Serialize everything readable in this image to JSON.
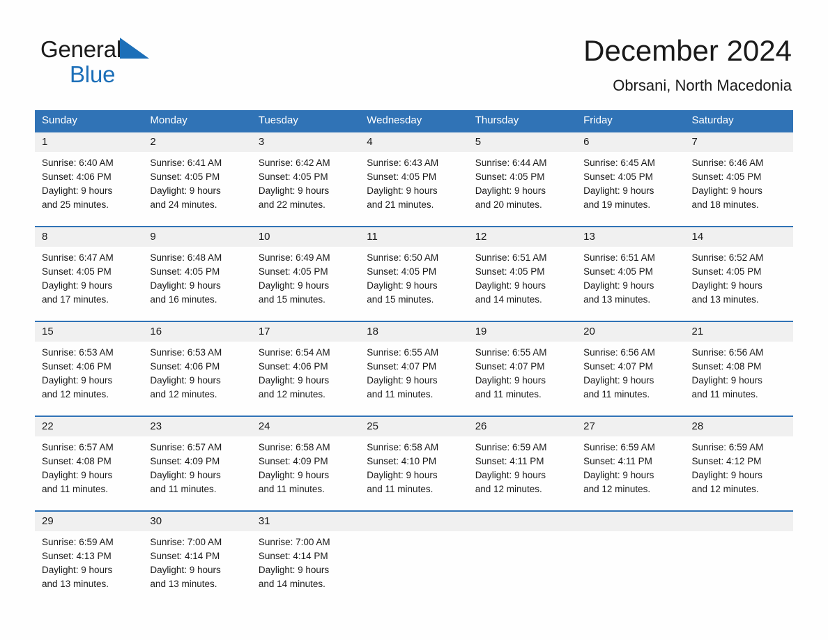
{
  "brand": {
    "name_part1": "General",
    "name_part2": "Blue",
    "triangle_icon": "triangle-icon",
    "accent_color": "#1C6FB8"
  },
  "header": {
    "month_title": "December 2024",
    "location": "Obrsani, North Macedonia",
    "header_bg_color": "#3073B6",
    "day_band_color": "#F0F0F0"
  },
  "weekday_headers": [
    "Sunday",
    "Monday",
    "Tuesday",
    "Wednesday",
    "Thursday",
    "Friday",
    "Saturday"
  ],
  "weeks": [
    {
      "numbers": [
        "1",
        "2",
        "3",
        "4",
        "5",
        "6",
        "7"
      ],
      "cells": [
        {
          "sunrise": "Sunrise: 6:40 AM",
          "sunset": "Sunset: 4:06 PM",
          "daylight1": "Daylight: 9 hours",
          "daylight2": "and 25 minutes."
        },
        {
          "sunrise": "Sunrise: 6:41 AM",
          "sunset": "Sunset: 4:05 PM",
          "daylight1": "Daylight: 9 hours",
          "daylight2": "and 24 minutes."
        },
        {
          "sunrise": "Sunrise: 6:42 AM",
          "sunset": "Sunset: 4:05 PM",
          "daylight1": "Daylight: 9 hours",
          "daylight2": "and 22 minutes."
        },
        {
          "sunrise": "Sunrise: 6:43 AM",
          "sunset": "Sunset: 4:05 PM",
          "daylight1": "Daylight: 9 hours",
          "daylight2": "and 21 minutes."
        },
        {
          "sunrise": "Sunrise: 6:44 AM",
          "sunset": "Sunset: 4:05 PM",
          "daylight1": "Daylight: 9 hours",
          "daylight2": "and 20 minutes."
        },
        {
          "sunrise": "Sunrise: 6:45 AM",
          "sunset": "Sunset: 4:05 PM",
          "daylight1": "Daylight: 9 hours",
          "daylight2": "and 19 minutes."
        },
        {
          "sunrise": "Sunrise: 6:46 AM",
          "sunset": "Sunset: 4:05 PM",
          "daylight1": "Daylight: 9 hours",
          "daylight2": "and 18 minutes."
        }
      ]
    },
    {
      "numbers": [
        "8",
        "9",
        "10",
        "11",
        "12",
        "13",
        "14"
      ],
      "cells": [
        {
          "sunrise": "Sunrise: 6:47 AM",
          "sunset": "Sunset: 4:05 PM",
          "daylight1": "Daylight: 9 hours",
          "daylight2": "and 17 minutes."
        },
        {
          "sunrise": "Sunrise: 6:48 AM",
          "sunset": "Sunset: 4:05 PM",
          "daylight1": "Daylight: 9 hours",
          "daylight2": "and 16 minutes."
        },
        {
          "sunrise": "Sunrise: 6:49 AM",
          "sunset": "Sunset: 4:05 PM",
          "daylight1": "Daylight: 9 hours",
          "daylight2": "and 15 minutes."
        },
        {
          "sunrise": "Sunrise: 6:50 AM",
          "sunset": "Sunset: 4:05 PM",
          "daylight1": "Daylight: 9 hours",
          "daylight2": "and 15 minutes."
        },
        {
          "sunrise": "Sunrise: 6:51 AM",
          "sunset": "Sunset: 4:05 PM",
          "daylight1": "Daylight: 9 hours",
          "daylight2": "and 14 minutes."
        },
        {
          "sunrise": "Sunrise: 6:51 AM",
          "sunset": "Sunset: 4:05 PM",
          "daylight1": "Daylight: 9 hours",
          "daylight2": "and 13 minutes."
        },
        {
          "sunrise": "Sunrise: 6:52 AM",
          "sunset": "Sunset: 4:05 PM",
          "daylight1": "Daylight: 9 hours",
          "daylight2": "and 13 minutes."
        }
      ]
    },
    {
      "numbers": [
        "15",
        "16",
        "17",
        "18",
        "19",
        "20",
        "21"
      ],
      "cells": [
        {
          "sunrise": "Sunrise: 6:53 AM",
          "sunset": "Sunset: 4:06 PM",
          "daylight1": "Daylight: 9 hours",
          "daylight2": "and 12 minutes."
        },
        {
          "sunrise": "Sunrise: 6:53 AM",
          "sunset": "Sunset: 4:06 PM",
          "daylight1": "Daylight: 9 hours",
          "daylight2": "and 12 minutes."
        },
        {
          "sunrise": "Sunrise: 6:54 AM",
          "sunset": "Sunset: 4:06 PM",
          "daylight1": "Daylight: 9 hours",
          "daylight2": "and 12 minutes."
        },
        {
          "sunrise": "Sunrise: 6:55 AM",
          "sunset": "Sunset: 4:07 PM",
          "daylight1": "Daylight: 9 hours",
          "daylight2": "and 11 minutes."
        },
        {
          "sunrise": "Sunrise: 6:55 AM",
          "sunset": "Sunset: 4:07 PM",
          "daylight1": "Daylight: 9 hours",
          "daylight2": "and 11 minutes."
        },
        {
          "sunrise": "Sunrise: 6:56 AM",
          "sunset": "Sunset: 4:07 PM",
          "daylight1": "Daylight: 9 hours",
          "daylight2": "and 11 minutes."
        },
        {
          "sunrise": "Sunrise: 6:56 AM",
          "sunset": "Sunset: 4:08 PM",
          "daylight1": "Daylight: 9 hours",
          "daylight2": "and 11 minutes."
        }
      ]
    },
    {
      "numbers": [
        "22",
        "23",
        "24",
        "25",
        "26",
        "27",
        "28"
      ],
      "cells": [
        {
          "sunrise": "Sunrise: 6:57 AM",
          "sunset": "Sunset: 4:08 PM",
          "daylight1": "Daylight: 9 hours",
          "daylight2": "and 11 minutes."
        },
        {
          "sunrise": "Sunrise: 6:57 AM",
          "sunset": "Sunset: 4:09 PM",
          "daylight1": "Daylight: 9 hours",
          "daylight2": "and 11 minutes."
        },
        {
          "sunrise": "Sunrise: 6:58 AM",
          "sunset": "Sunset: 4:09 PM",
          "daylight1": "Daylight: 9 hours",
          "daylight2": "and 11 minutes."
        },
        {
          "sunrise": "Sunrise: 6:58 AM",
          "sunset": "Sunset: 4:10 PM",
          "daylight1": "Daylight: 9 hours",
          "daylight2": "and 11 minutes."
        },
        {
          "sunrise": "Sunrise: 6:59 AM",
          "sunset": "Sunset: 4:11 PM",
          "daylight1": "Daylight: 9 hours",
          "daylight2": "and 12 minutes."
        },
        {
          "sunrise": "Sunrise: 6:59 AM",
          "sunset": "Sunset: 4:11 PM",
          "daylight1": "Daylight: 9 hours",
          "daylight2": "and 12 minutes."
        },
        {
          "sunrise": "Sunrise: 6:59 AM",
          "sunset": "Sunset: 4:12 PM",
          "daylight1": "Daylight: 9 hours",
          "daylight2": "and 12 minutes."
        }
      ]
    },
    {
      "numbers": [
        "29",
        "30",
        "31",
        "",
        "",
        "",
        ""
      ],
      "cells": [
        {
          "sunrise": "Sunrise: 6:59 AM",
          "sunset": "Sunset: 4:13 PM",
          "daylight1": "Daylight: 9 hours",
          "daylight2": "and 13 minutes."
        },
        {
          "sunrise": "Sunrise: 7:00 AM",
          "sunset": "Sunset: 4:14 PM",
          "daylight1": "Daylight: 9 hours",
          "daylight2": "and 13 minutes."
        },
        {
          "sunrise": "Sunrise: 7:00 AM",
          "sunset": "Sunset: 4:14 PM",
          "daylight1": "Daylight: 9 hours",
          "daylight2": "and 14 minutes."
        },
        {
          "sunrise": "",
          "sunset": "",
          "daylight1": "",
          "daylight2": ""
        },
        {
          "sunrise": "",
          "sunset": "",
          "daylight1": "",
          "daylight2": ""
        },
        {
          "sunrise": "",
          "sunset": "",
          "daylight1": "",
          "daylight2": ""
        },
        {
          "sunrise": "",
          "sunset": "",
          "daylight1": "",
          "daylight2": ""
        }
      ]
    }
  ]
}
